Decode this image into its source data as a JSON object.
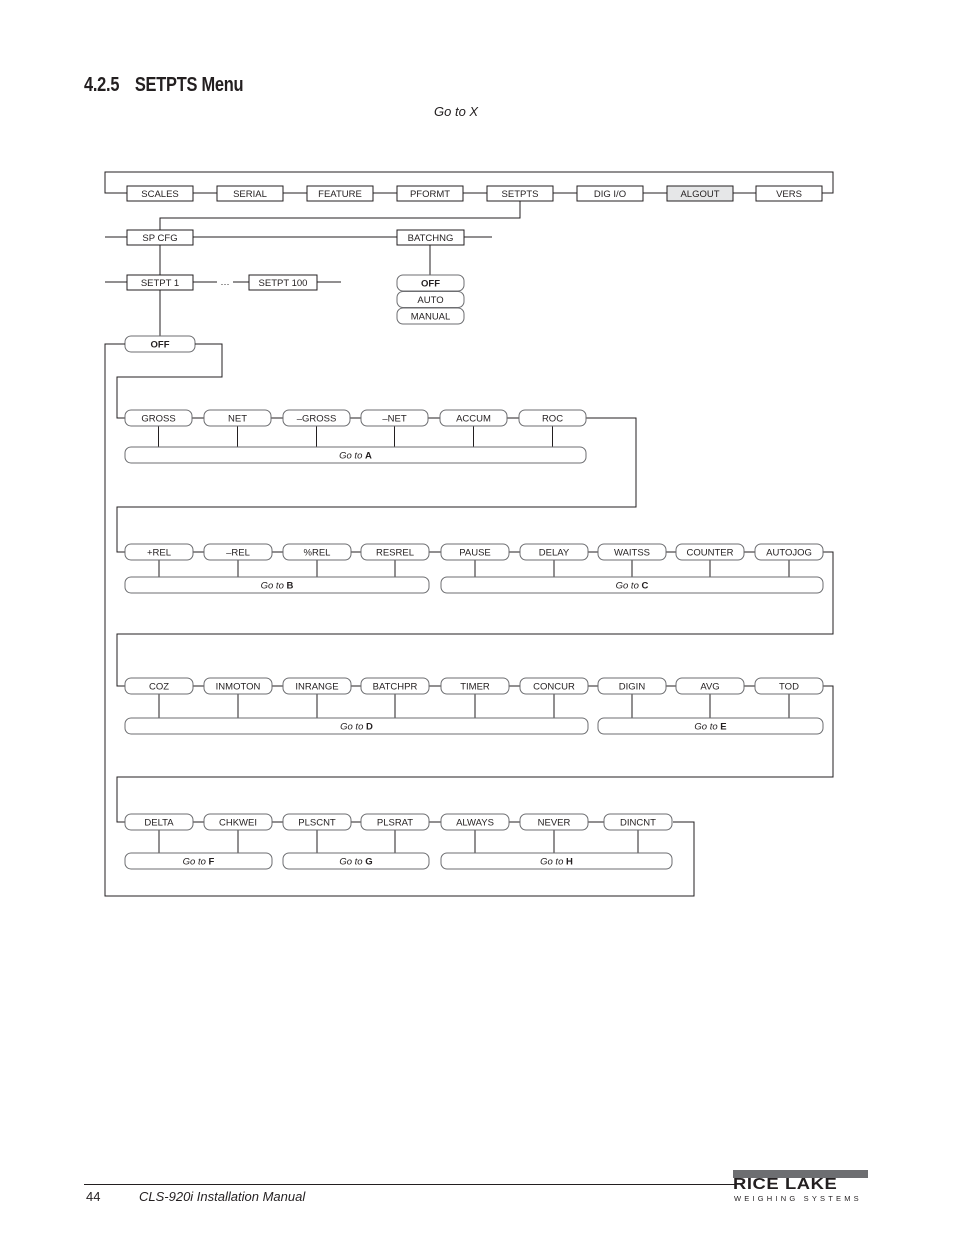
{
  "heading": {
    "number": "4.2.5",
    "title": "SETPTS Menu"
  },
  "goto_x_label": "Go to X",
  "diagram": {
    "top_menu": [
      {
        "label": "SCALES",
        "highlighted": false
      },
      {
        "label": "SERIAL",
        "highlighted": false
      },
      {
        "label": "FEATURE",
        "highlighted": false
      },
      {
        "label": "PFORMT",
        "highlighted": false
      },
      {
        "label": "SETPTS",
        "highlighted": false
      },
      {
        "label": "DIG I/O",
        "highlighted": false
      },
      {
        "label": "ALGOUT",
        "highlighted": true
      },
      {
        "label": "VERS",
        "highlighted": false
      }
    ],
    "level2": [
      {
        "label": "SP CFG"
      },
      {
        "label": "BATCHNG"
      }
    ],
    "setpoints": [
      {
        "label": "SETPT 1"
      },
      {
        "label": "SETPT 100"
      }
    ],
    "ellipsis": "…",
    "batching_options": [
      {
        "label": "OFF",
        "default": true
      },
      {
        "label": "AUTO",
        "default": false
      },
      {
        "label": "MANUAL",
        "default": false
      }
    ],
    "kind_default": {
      "label": "OFF"
    },
    "rows": [
      {
        "items": [
          "GROSS",
          "NET",
          "–GROSS",
          "–NET",
          "ACCUM",
          "ROC"
        ],
        "groups": [
          {
            "prefix": "Go to",
            "target": "A",
            "from": 0,
            "to": 5
          }
        ]
      },
      {
        "items": [
          "+REL",
          "–REL",
          "%REL",
          "RESREL",
          "PAUSE",
          "DELAY",
          "WAITSS",
          "COUNTER",
          "AUTOJOG"
        ],
        "groups": [
          {
            "prefix": "Go to",
            "target": "B",
            "from": 0,
            "to": 3
          },
          {
            "prefix": "Go to",
            "target": "C",
            "from": 4,
            "to": 8
          }
        ]
      },
      {
        "items": [
          "COZ",
          "INMOTON",
          "INRANGE",
          "BATCHPR",
          "TIMER",
          "CONCUR",
          "DIGIN",
          "AVG",
          "TOD"
        ],
        "groups": [
          {
            "prefix": "Go to",
            "target": "D",
            "from": 0,
            "to": 5
          },
          {
            "prefix": "Go to",
            "target": "E",
            "from": 6,
            "to": 8
          }
        ]
      },
      {
        "items": [
          "DELTA",
          "CHKWEI",
          "PLSCNT",
          "PLSRAT",
          "ALWAYS",
          "NEVER",
          "DINCNT"
        ],
        "groups": [
          {
            "prefix": "Go to",
            "target": "F",
            "from": 0,
            "to": 1
          },
          {
            "prefix": "Go to",
            "target": "G",
            "from": 2,
            "to": 3
          },
          {
            "prefix": "Go to",
            "target": "H",
            "from": 4,
            "to": 6
          }
        ]
      }
    ]
  },
  "footer": {
    "page_number": "44",
    "manual_title": "CLS-920i Installation Manual",
    "logo_main": "RICE LAKE",
    "logo_sub": "WEIGHING SYSTEMS"
  },
  "colors": {
    "line": "#231f20",
    "text": "#231f20",
    "pill_stroke": "#6d6e71",
    "highlight_fill": "#e6e7e8"
  }
}
